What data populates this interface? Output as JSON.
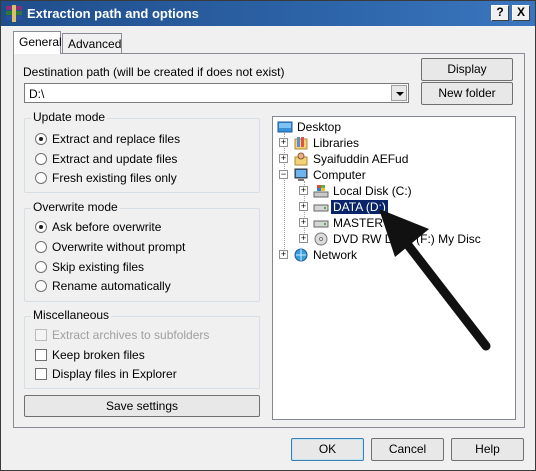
{
  "window": {
    "title": "Extraction path and options",
    "help_button": "?",
    "close_button": "X"
  },
  "tabs": [
    "General",
    "Advanced"
  ],
  "destination": {
    "label": "Destination path (will be created if does not exist)",
    "value": "D:\\"
  },
  "side_buttons": {
    "display": "Display",
    "new_folder": "New folder"
  },
  "update_mode": {
    "title": "Update mode",
    "options": [
      "Extract and replace files",
      "Extract and update files",
      "Fresh existing files only"
    ],
    "selected": 0
  },
  "overwrite_mode": {
    "title": "Overwrite mode",
    "options": [
      "Ask before overwrite",
      "Overwrite without prompt",
      "Skip existing files",
      "Rename automatically"
    ],
    "selected": 0
  },
  "miscellaneous": {
    "title": "Miscellaneous",
    "options": [
      "Extract archives to subfolders",
      "Keep broken files",
      "Display files in Explorer"
    ],
    "disabled": [
      true,
      false,
      false
    ],
    "checked": [
      false,
      false,
      false
    ]
  },
  "save_settings": "Save settings",
  "tree": {
    "items": [
      {
        "label": "Desktop",
        "icon": "desktop-icon"
      },
      {
        "label": "Libraries",
        "icon": "libraries-icon"
      },
      {
        "label": "Syaifuddin AEFud",
        "icon": "user-folder-icon"
      },
      {
        "label": "Computer",
        "icon": "computer-icon"
      },
      {
        "label": "Local Disk (C:)",
        "icon": "windows-drive-icon"
      },
      {
        "label": "DATA (D:)",
        "icon": "drive-icon"
      },
      {
        "label": "MASTER (E:)",
        "icon": "drive-icon"
      },
      {
        "label": "DVD RW Drive (F:) My Disc",
        "icon": "dvd-drive-icon"
      },
      {
        "label": "Network",
        "icon": "network-icon"
      }
    ],
    "selected": "DATA (D:)"
  },
  "footer": {
    "ok": "OK",
    "cancel": "Cancel",
    "help": "Help"
  },
  "annotation": {
    "icon": "pointer-arrow-icon",
    "color": "#111111"
  },
  "colors": {
    "title_bar": "#2d64a8",
    "selection": "#0a246a"
  }
}
